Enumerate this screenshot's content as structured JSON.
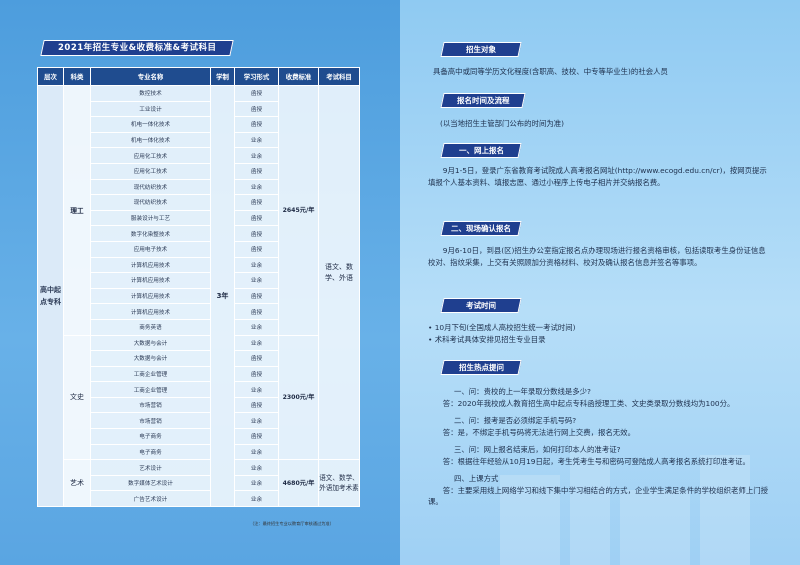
{
  "table_title": "2021年招生专业&收费标准&考试科目",
  "table": {
    "headers": [
      "层次",
      "科类",
      "专业名称",
      "学制",
      "学习形式",
      "收费标准",
      "考试科目"
    ],
    "level": "高中起点专科",
    "duration": "3年",
    "groups": [
      {
        "category": "理工",
        "fee": "2645元/年",
        "subjects": "语文、数学、外语",
        "rows": [
          {
            "major": "数控技术",
            "form": "函授"
          },
          {
            "major": "工业设计",
            "form": "函授"
          },
          {
            "major": "机电一体化技术",
            "form": "函授"
          },
          {
            "major": "机电一体化技术",
            "form": "业余"
          },
          {
            "major": "应用化工技术",
            "form": "业余"
          },
          {
            "major": "应用化工技术",
            "form": "函授"
          },
          {
            "major": "现代纺织技术",
            "form": "业余"
          },
          {
            "major": "现代纺织技术",
            "form": "函授"
          },
          {
            "major": "服装设计与工艺",
            "form": "函授"
          },
          {
            "major": "数字化染整技术",
            "form": "函授"
          },
          {
            "major": "应用电子技术",
            "form": "函授"
          },
          {
            "major": "计算机应用技术",
            "form": "业余"
          },
          {
            "major": "计算机应用技术",
            "form": "业余"
          },
          {
            "major": "计算机应用技术",
            "form": "函授"
          },
          {
            "major": "计算机应用技术",
            "form": "函授"
          },
          {
            "major": "商务英语",
            "form": "业余"
          }
        ]
      },
      {
        "category": "文史",
        "fee": "2300元/年",
        "subjects": "",
        "rows": [
          {
            "major": "大数据与会计",
            "form": "业余"
          },
          {
            "major": "大数据与会计",
            "form": "函授"
          },
          {
            "major": "工商企业管理",
            "form": "函授"
          },
          {
            "major": "工商企业管理",
            "form": "业余"
          },
          {
            "major": "市场营销",
            "form": "函授"
          },
          {
            "major": "市场营销",
            "form": "业余"
          },
          {
            "major": "电子商务",
            "form": "函授"
          },
          {
            "major": "电子商务",
            "form": "业余"
          }
        ]
      },
      {
        "category": "艺术",
        "fee": "4680元/年",
        "subjects": "语文、数学、外语加考术素",
        "rows": [
          {
            "major": "艺术设计",
            "form": "业余"
          },
          {
            "major": "数字媒体艺术设计",
            "form": "业余"
          },
          {
            "major": "广告艺术设计",
            "form": "业余"
          }
        ]
      }
    ],
    "footnote": "（注：最终招生专业以教育厅审核通过为准）"
  },
  "sections": {
    "target_title": "招生对象",
    "target_text": "具备高中或同等学历文化程度(含职高、技校、中专等毕业生)的社会人员",
    "schedule_title": "报名时间及流程",
    "schedule_text": "(以当地招生主管部门公布的时间为准)",
    "online_title": "一、网上报名",
    "online_text": "9月1-5日，登录广东省教育考试院成人高考报名网址(http://www.ecogd.edu.cn/cr)，按网页提示填报个人基本资料、填报志愿、通过小程序上传电子相片并交纳报名费。",
    "onsite_title": "二、现场确认报名",
    "onsite_text": "9月6-10日，到县(区)招生办公室指定报名点办理现场进行报名资格审核，包括读取考生身份证信息校对、指纹采集，上交有关照顾加分资格材料、校对及确认报名信息并签名等事项。",
    "exam_title": "考试时间",
    "exam_item1": "• 10月下旬(全国成人高校招生统一考试时间)",
    "exam_item2": "• 术科考试具体安排见招生专业目录",
    "faq_title": "招生热点提问",
    "faq": [
      {
        "q": "一、问：贵校的上一年录取分数线是多少?",
        "a": "答：2020年我校成人教育招生高中起点专科函授理工类、文史类录取分数线均为100分。"
      },
      {
        "q": "二、问：报考是否必须绑定手机号码?",
        "a": "答：是，不绑定手机号码将无法进行网上交费，报名无效。"
      },
      {
        "q": "三、问：网上报名结束后，如何打印本人的准考证?",
        "a": "答：根据往年经验从10月19日起，考生凭考生号和密码可登陆成人高考报名系统打印准考证。"
      },
      {
        "q": "四、上课方式",
        "a": "答：主要采用线上网络学习和线下集中学习相结合的方式，企业学生满足条件的学校组织老师上门授课。"
      }
    ]
  }
}
